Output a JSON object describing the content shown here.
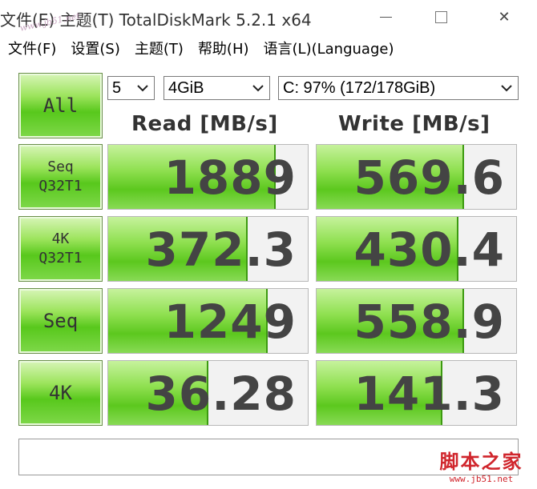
{
  "window": {
    "title": "文件(E)  主题(T)  TotalDiskMark 5.2.1 x64",
    "watermark_top": "www.jb51.net",
    "min_icon": "minimize-icon",
    "max_icon": "maximize-icon",
    "close_icon": "close-icon",
    "close_glyph": "✕"
  },
  "menu": [
    {
      "label": "文件(F)"
    },
    {
      "label": "设置(S)"
    },
    {
      "label": "主题(T)"
    },
    {
      "label": "帮助(H)"
    },
    {
      "label": "语言(L)(Language)"
    }
  ],
  "controls": {
    "all_label": "All",
    "count_value": "5",
    "size_value": "4GiB",
    "drive_value": "C: 97% (172/178GiB)"
  },
  "headers": {
    "read": "Read [MB/s]",
    "write": "Write [MB/s]"
  },
  "rows": [
    {
      "label": "Seq\nQ32T1",
      "read": "1889",
      "write": "569.6",
      "read_fill": 0.84,
      "write_fill": 0.74
    },
    {
      "label": "4K\nQ32T1",
      "read": "372.3",
      "write": "430.4",
      "read_fill": 0.7,
      "write_fill": 0.71
    },
    {
      "label": "Seq",
      "read": "1249",
      "write": "558.9",
      "read_fill": 0.8,
      "write_fill": 0.74
    },
    {
      "label": "4K",
      "read": "36.28",
      "write": "141.3",
      "read_fill": 0.5,
      "write_fill": 0.63
    }
  ],
  "status_text": "",
  "watermark_bottom": {
    "cn": "脚本之家",
    "url": "www.jb51.net"
  }
}
